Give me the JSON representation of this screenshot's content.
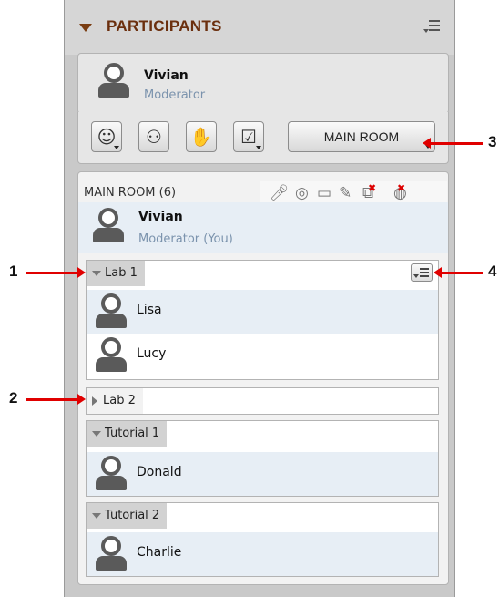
{
  "panel": {
    "title": "PARTICIPANTS",
    "menu_icon": "panel-menu-icon"
  },
  "current_user": {
    "name": "Vivian",
    "role": "Moderator"
  },
  "toolbar": {
    "buttons": [
      {
        "icon": "emoticon-icon"
      },
      {
        "icon": "user-status-icon"
      },
      {
        "icon": "raise-hand-icon"
      },
      {
        "icon": "checkbox-icon"
      }
    ],
    "room_button_label": "MAIN ROOM"
  },
  "main_room": {
    "label": "MAIN ROOM (6)",
    "action_icons": [
      "microphone-icon",
      "webcam-icon",
      "chat-icon",
      "pencil-icon",
      "remove-copy-icon",
      "remove-globe-icon"
    ],
    "me": {
      "name": "Vivian",
      "role": "Moderator (You)"
    }
  },
  "groups": [
    {
      "name": "Lab 1",
      "expanded": true,
      "members": [
        "Lisa",
        "Lucy"
      ]
    },
    {
      "name": "Lab 2",
      "expanded": false,
      "members": []
    },
    {
      "name": "Tutorial 1",
      "expanded": true,
      "members": [
        "Donald"
      ]
    },
    {
      "name": "Tutorial 2",
      "expanded": true,
      "members": [
        "Charlie"
      ]
    }
  ],
  "callouts": [
    "1",
    "2",
    "3",
    "4"
  ],
  "colors": {
    "header_title": "#6b2f0e",
    "role_text": "#7b93ad",
    "callout_arrow": "#e00000",
    "row_highlight": "#e7eef5"
  }
}
